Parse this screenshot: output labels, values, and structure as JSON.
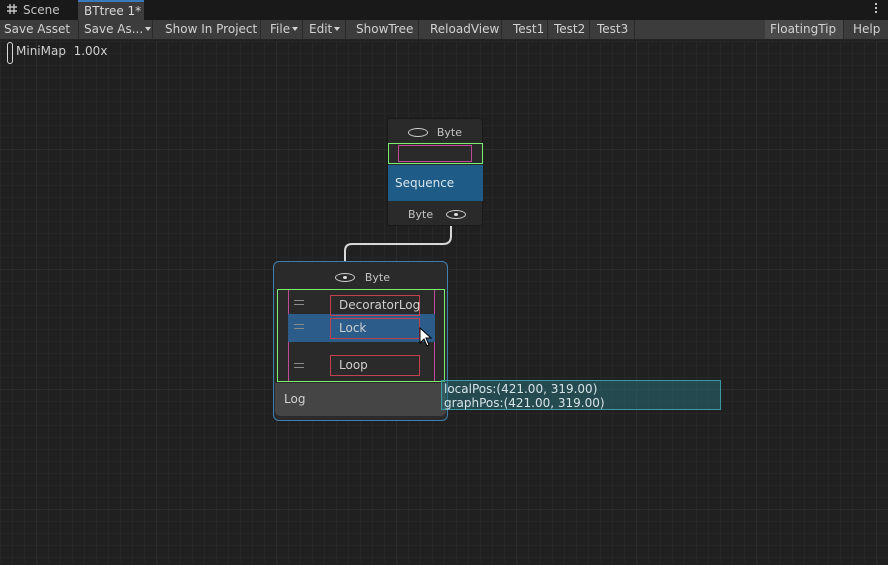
{
  "tabs": [
    {
      "label": "Scene",
      "icon": "grid-hash-icon"
    },
    {
      "label": "BTtree 1*"
    }
  ],
  "toolbar": {
    "save_asset": "Save Asset",
    "save_as": "Save As...",
    "show_in_project": "Show In Project",
    "file": "File",
    "edit": "Edit",
    "show_tree": "ShowTree",
    "reload_view": "ReloadView",
    "test1": "Test1",
    "test2": "Test2",
    "test3": "Test3",
    "floating_tip": "FloatingTip",
    "help": "Help"
  },
  "minimap": {
    "label": "MiniMap",
    "zoom": "1.00x"
  },
  "sequence_node": {
    "in_port": "Byte",
    "title": "Sequence",
    "out_port": "Byte"
  },
  "log_node": {
    "in_port": "Byte",
    "decorators": [
      "DecoratorLog",
      "Lock",
      "Loop"
    ],
    "title": "Log"
  },
  "tooltip": {
    "local_pos": "localPos:(421.00, 319.00)",
    "graph_pos": "graphPos:(421.00, 319.00)"
  },
  "colors": {
    "selection": "#2c5d8a",
    "sequence_title": "#1e5b86",
    "slot_outline": "#7cf06e",
    "decorator_outline": "#c2414e",
    "tooltip": "#3a9aa4"
  }
}
